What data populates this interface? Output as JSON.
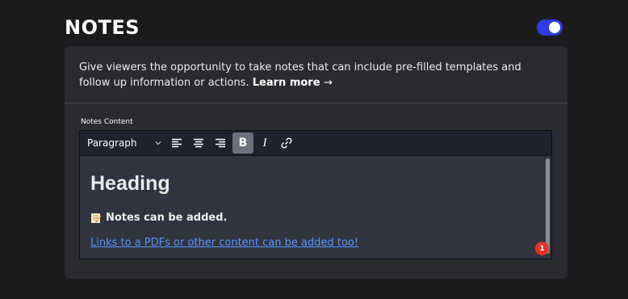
{
  "section": {
    "title": "NOTES",
    "toggle_on": true
  },
  "card": {
    "description": "Give viewers the opportunity to take notes that can include pre-filled templates and follow up information or actions.",
    "learn_more": "Learn more",
    "learn_more_arrow": "→",
    "field_label": "Notes Content"
  },
  "toolbar": {
    "paragraph_select": "Paragraph",
    "buttons": [
      {
        "name": "align-left-icon"
      },
      {
        "name": "align-center-icon"
      },
      {
        "name": "align-right-icon"
      },
      {
        "name": "bold-icon",
        "label": "B",
        "active": true
      },
      {
        "name": "italic-icon",
        "label": "I"
      },
      {
        "name": "link-icon"
      }
    ]
  },
  "content": {
    "heading": "Heading",
    "note_line": "Notes can be added.",
    "link_text": "Links to a PDFs or other content can be added too!",
    "note_emoji_icon": "memo-icon"
  },
  "badge": {
    "count": "1",
    "color": "#e0342c"
  },
  "colors": {
    "toggle_accent": "#2f3bdc",
    "link": "#5a95ff"
  }
}
